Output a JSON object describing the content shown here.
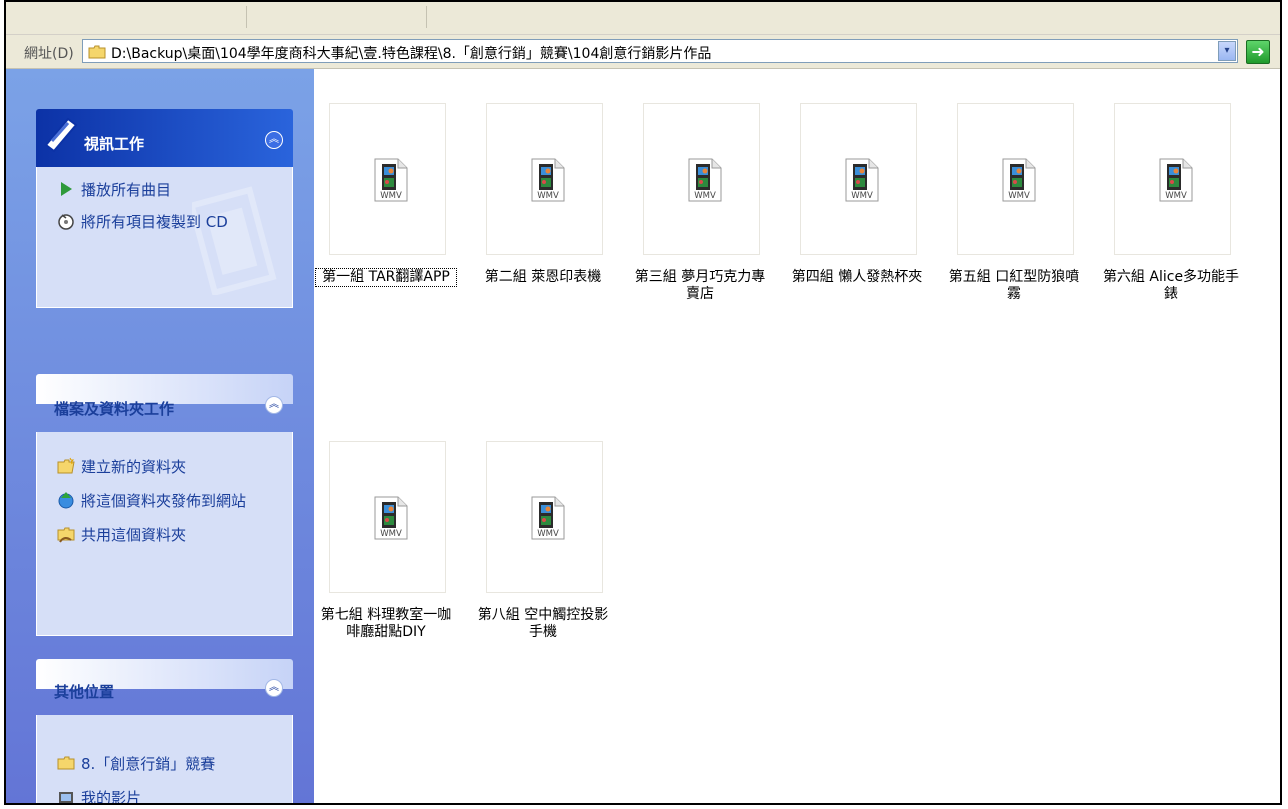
{
  "address": {
    "label": "網址(D)",
    "path": "D:\\Backup\\桌面\\104學年度商科大事紀\\壹.特色課程\\8.「創意行銷」競賽\\104創意行銷影片作品"
  },
  "sidebar": {
    "video_tasks": {
      "title": "視訊工作",
      "items": [
        "播放所有曲目",
        "將所有項目複製到 CD"
      ]
    },
    "file_tasks": {
      "title": "檔案及資料夾工作",
      "items": [
        "建立新的資料夾",
        "將這個資料夾發佈到網站",
        "共用這個資料夾"
      ]
    },
    "other_places": {
      "title": "其他位置",
      "items": [
        "8.「創意行銷」競賽",
        "我的影片"
      ]
    }
  },
  "files": [
    {
      "line1": "第一組 TAR翻譯APP",
      "line2": ""
    },
    {
      "line1": "第二組 萊恩印表機",
      "line2": ""
    },
    {
      "line1": "第三組 夢月巧克力專",
      "line2": "賣店"
    },
    {
      "line1": "第四組 懶人發熱杯夾",
      "line2": ""
    },
    {
      "line1": "第五組 口紅型防狼噴",
      "line2": "霧"
    },
    {
      "line1": "第六組 Alice多功能手",
      "line2": "錶"
    },
    {
      "line1": "第七組 料理教室一咖",
      "line2": "啡廳甜點DIY"
    },
    {
      "line1": "第八組 空中觸控投影",
      "line2": "手機"
    }
  ],
  "file_type_badge": "WMV",
  "icons": {
    "folder": "folder-icon",
    "play": "play-icon",
    "cd": "cd-copy-icon",
    "go": "go-arrow-icon",
    "video_file": "wmv-file-icon"
  },
  "colors": {
    "pane_blue": "#6e8fe0",
    "panel_text": "#1b3f9b",
    "special_header": "#0c32a6"
  }
}
